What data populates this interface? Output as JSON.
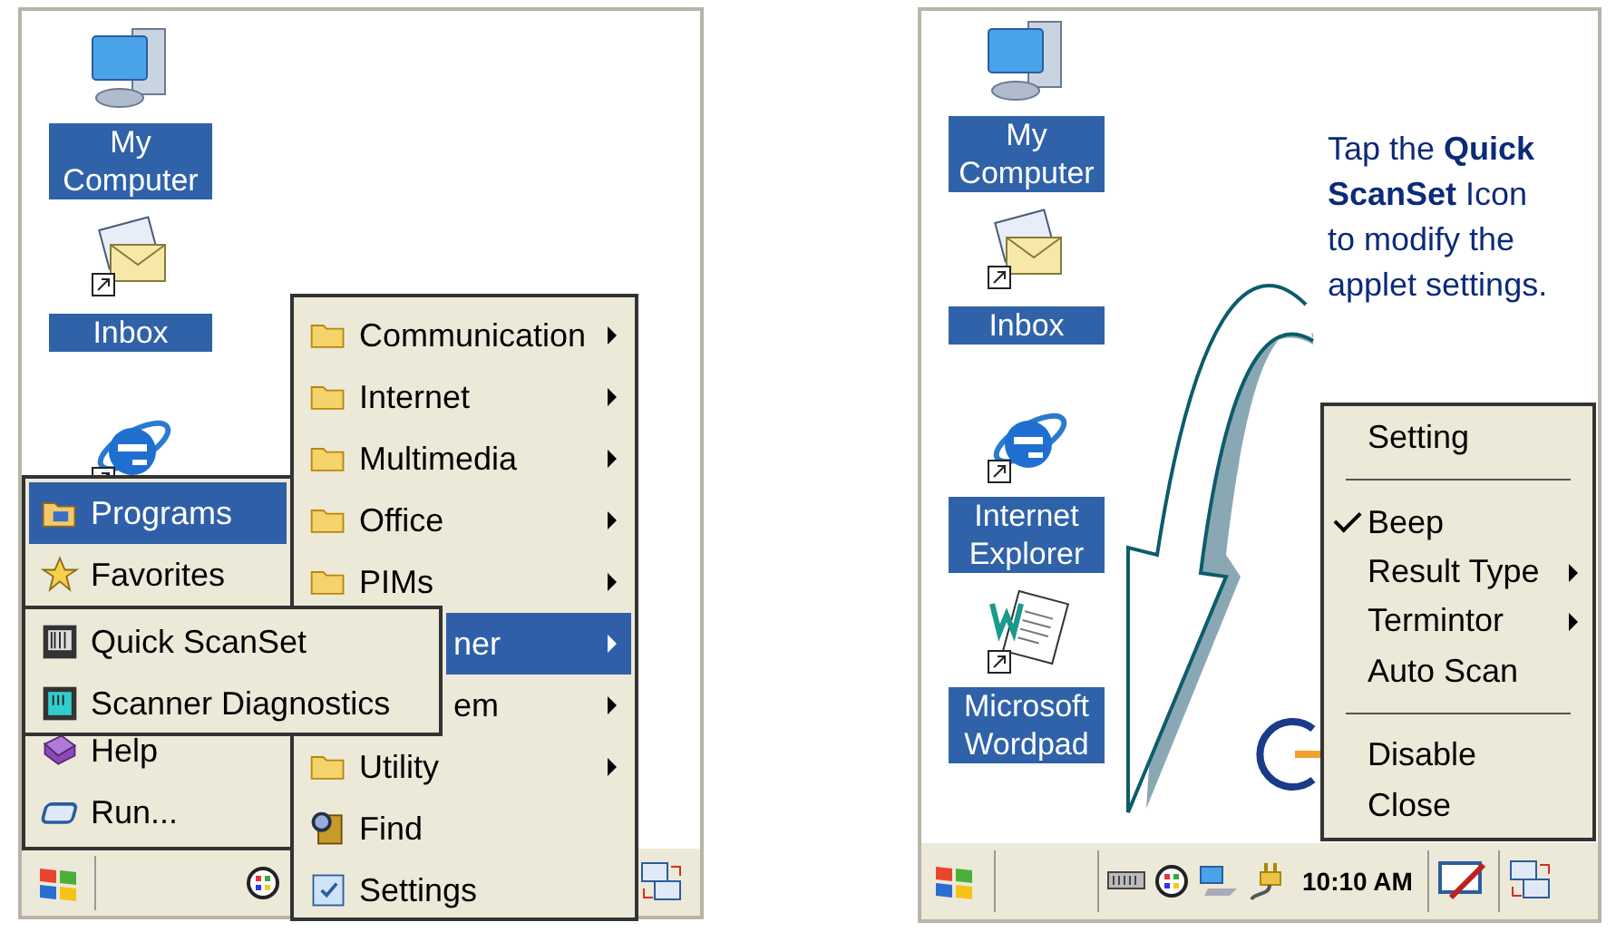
{
  "left_screen": {
    "desktop_icons": [
      {
        "label": "My Computer",
        "kind": "computer"
      },
      {
        "label": "Inbox",
        "kind": "inbox"
      },
      {
        "kind": "browser"
      }
    ],
    "programs_menu": [
      {
        "label": "Communication",
        "kind": "folder",
        "selected": false,
        "submenu": true,
        "covered": false
      },
      {
        "label": "Internet",
        "kind": "folder",
        "selected": false,
        "submenu": true,
        "covered": false
      },
      {
        "label": "Multimedia",
        "kind": "folder",
        "selected": false,
        "submenu": true,
        "covered": false
      },
      {
        "label": "Office",
        "kind": "folder",
        "selected": false,
        "submenu": true,
        "covered": false
      },
      {
        "label": "PIMs",
        "kind": "folder",
        "selected": false,
        "submenu": true,
        "covered": false
      },
      {
        "label": "ner",
        "selected": true,
        "submenu": true,
        "covered": true
      },
      {
        "label": "em",
        "selected": false,
        "submenu": true,
        "covered": true
      },
      {
        "label": "Utility",
        "kind": "folder",
        "selected": false,
        "submenu": true,
        "covered": false
      },
      {
        "label": "Find",
        "kind": "find",
        "selected": false,
        "submenu": false,
        "covered": false
      },
      {
        "label": "Settings",
        "kind": "settings",
        "selected": false,
        "submenu": false,
        "covered": false
      }
    ],
    "start_menu": {
      "top_items": [
        {
          "label": "Programs",
          "kind": "programs",
          "selected": true
        },
        {
          "label": "Favorites",
          "kind": "favorites",
          "selected": false
        }
      ],
      "bottom_items": [
        {
          "label": "Help",
          "kind": "help",
          "selected": false
        },
        {
          "label": "Run...",
          "kind": "run",
          "selected": false
        }
      ]
    },
    "scanner_menu": [
      {
        "label": "Quick ScanSet",
        "kind": "quickscan",
        "selected": false
      },
      {
        "label": "Scanner Diagnostics",
        "kind": "diagnostics",
        "selected": false
      }
    ]
  },
  "right_screen": {
    "desktop_icons": [
      {
        "label": "My Computer",
        "kind": "computer"
      },
      {
        "label": "Inbox",
        "kind": "inbox"
      },
      {
        "label": "Internet Explorer",
        "kind": "browser"
      },
      {
        "label": "Microsoft Wordpad",
        "kind": "wordpad"
      }
    ],
    "callout": "Tap the **Quick ScanSet** Icon to modify the applet settings.",
    "popup_menu": [
      {
        "kind": "item",
        "label": "Setting",
        "checked": false,
        "submenu": false
      },
      {
        "kind": "separator"
      },
      {
        "kind": "item",
        "label": "Beep",
        "checked": true,
        "submenu": false
      },
      {
        "kind": "item",
        "label": "Result Type",
        "checked": false,
        "submenu": true
      },
      {
        "kind": "item",
        "label": "Termintor",
        "checked": false,
        "submenu": true
      },
      {
        "kind": "item",
        "label": "Auto Scan",
        "checked": false,
        "submenu": false
      },
      {
        "kind": "separator"
      },
      {
        "kind": "item",
        "label": "Disable",
        "checked": false,
        "submenu": false
      },
      {
        "kind": "item",
        "label": "Close",
        "checked": false,
        "submenu": false
      }
    ],
    "taskbar": {
      "time": "10:10 AM"
    }
  }
}
